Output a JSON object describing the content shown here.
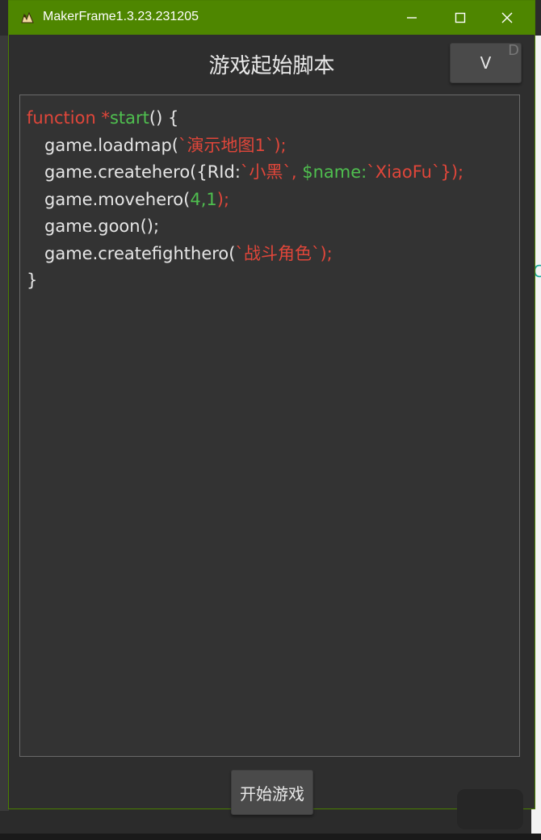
{
  "window": {
    "title": "MakerFrame1.3.23.231205",
    "controls": {
      "minimize": "—",
      "maximize": "☐",
      "close": "✕"
    }
  },
  "header": {
    "title": "游戏起始脚本",
    "v_button_label": "V",
    "v_button_ghost": "D"
  },
  "editor": {
    "line1": {
      "kw": "function",
      "star": " *",
      "fn": "start",
      "rest": "() {"
    },
    "line2": {
      "a": "game.loadmap(",
      "s": "`演示地图1`",
      "b": ");"
    },
    "line3": {
      "a": "game.createhero({RId:",
      "s1": "`小黑`",
      "comma": ", ",
      "k": "$name:",
      "s2": "`XiaoFu`",
      "b": "});"
    },
    "line4": {
      "a": "game.movehero(",
      "n": "4,1",
      "b": ");"
    },
    "line5": {
      "a": "game.goon();"
    },
    "line6": {
      "a": "game.createfighthero(",
      "s": "`战斗角色`",
      "b": ");"
    },
    "line7": {
      "a": "}"
    }
  },
  "footer": {
    "start_button_label": "开始游戏"
  },
  "colors": {
    "titlebar": "#4e8600",
    "keyword": "#e0463a",
    "function_name": "#4fbf4f",
    "string": "#e0463a",
    "number": "#4fbf4f",
    "editor_bg": "#333333"
  }
}
